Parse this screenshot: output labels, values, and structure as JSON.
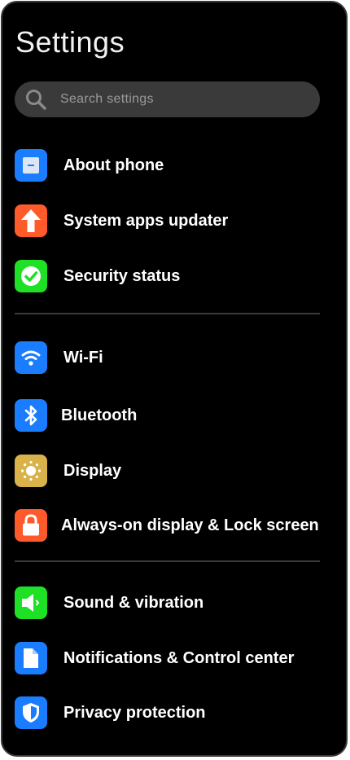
{
  "header": {
    "title": "Settings"
  },
  "search": {
    "placeholder": "Search settings"
  },
  "groups": [
    {
      "items": [
        {
          "label": "About phone",
          "icon": "phone-info-icon",
          "color": "#1a7cff"
        },
        {
          "label": "System apps updater",
          "icon": "arrow-up-icon",
          "color": "#ff5a2a"
        },
        {
          "label": "Security status",
          "icon": "check-circle-icon",
          "color": "#1ee024"
        }
      ]
    },
    {
      "items": [
        {
          "label": "Wi-Fi",
          "icon": "wifi-icon",
          "color": "#1a7cff"
        },
        {
          "label": "Bluetooth",
          "icon": "bluetooth-icon",
          "color": "#1a7cff"
        },
        {
          "label": "Display",
          "icon": "sun-icon",
          "color": "#d9b24a"
        },
        {
          "label": "Always-on display & Lock screen",
          "icon": "lock-icon",
          "color": "#ff5a2a"
        }
      ]
    },
    {
      "items": [
        {
          "label": "Sound & vibration",
          "icon": "speaker-icon",
          "color": "#1ee024"
        },
        {
          "label": "Notifications & Control center",
          "icon": "notification-document-icon",
          "color": "#1a7cff"
        },
        {
          "label": "Privacy protection",
          "icon": "shield-icon",
          "color": "#1a7cff"
        }
      ]
    }
  ]
}
